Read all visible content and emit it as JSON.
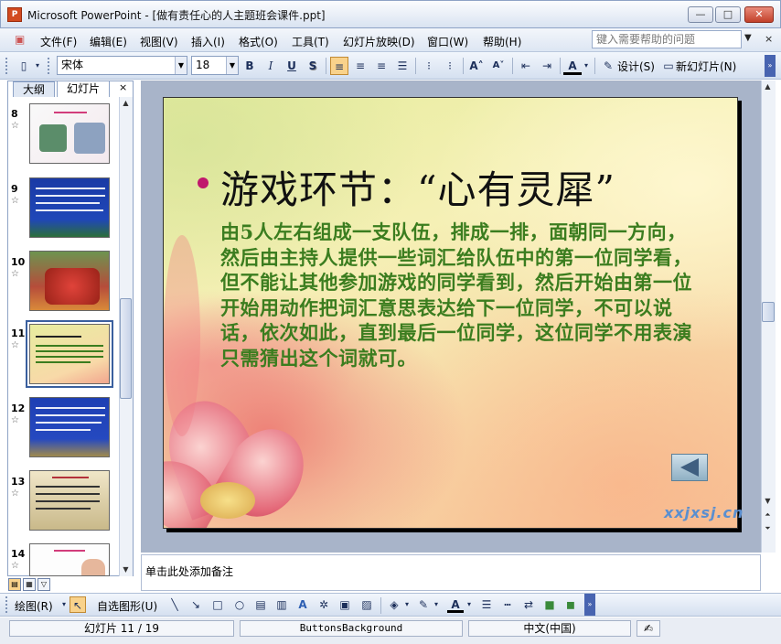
{
  "window": {
    "title": "Microsoft PowerPoint - [做有责任心的人主题班会课件.ppt]",
    "icon_text": "P",
    "controls": {
      "minimize": "—",
      "maximize": "□",
      "close": "✕"
    }
  },
  "menubar": {
    "items": [
      "文件(F)",
      "编辑(E)",
      "视图(V)",
      "插入(I)",
      "格式(O)",
      "工具(T)",
      "幻灯片放映(D)",
      "窗口(W)",
      "帮助(H)"
    ],
    "help_placeholder": "键入需要帮助的问题",
    "close_glyph": "×"
  },
  "toolbar": {
    "font_name": "宋体",
    "font_size": "18",
    "bold": "B",
    "italic": "I",
    "underline": "U",
    "shadow": "S",
    "design_label": "设计(S)",
    "new_slide_label": "新幻灯片(N)",
    "font_color_glyph": "A"
  },
  "left_pane": {
    "tab_outline": "大纲",
    "tab_slides": "幻灯片",
    "close_glyph": "×",
    "thumbnails": [
      {
        "number": "8",
        "star": "☆"
      },
      {
        "number": "9",
        "star": "☆"
      },
      {
        "number": "10",
        "star": "☆"
      },
      {
        "number": "11",
        "star": "☆"
      },
      {
        "number": "12",
        "star": "☆"
      },
      {
        "number": "13",
        "star": "☆"
      },
      {
        "number": "14",
        "star": "☆"
      }
    ],
    "selected_slide": 11
  },
  "slide": {
    "title": "游戏环节：“心有灵犀”",
    "body": "由5人左右组成一支队伍，排成一排，面朝同一方向，然后由主持人提供一些词汇给队伍中的第一位同学看，但不能让其他参加游戏的同学看到，然后开始由第一位开始用动作把词汇意思表达给下一位同学，不可以说话，依次如此，直到最后一位同学，这位同学不用表演只需猜出这个词就可。",
    "watermark": "xxjxsj.cn",
    "title_color": "#111111",
    "body_color": "#3b7d1f",
    "bullet_color": "#c0186c"
  },
  "notes": {
    "placeholder": "单击此处添加备注"
  },
  "drawbar": {
    "draw_label": "绘图(R)",
    "autoshapes_label": "自选图形(U)"
  },
  "statusbar": {
    "slide_position": "幻灯片 11 / 19",
    "design_name": "ButtonsBackground",
    "language": "中文(中国)"
  }
}
